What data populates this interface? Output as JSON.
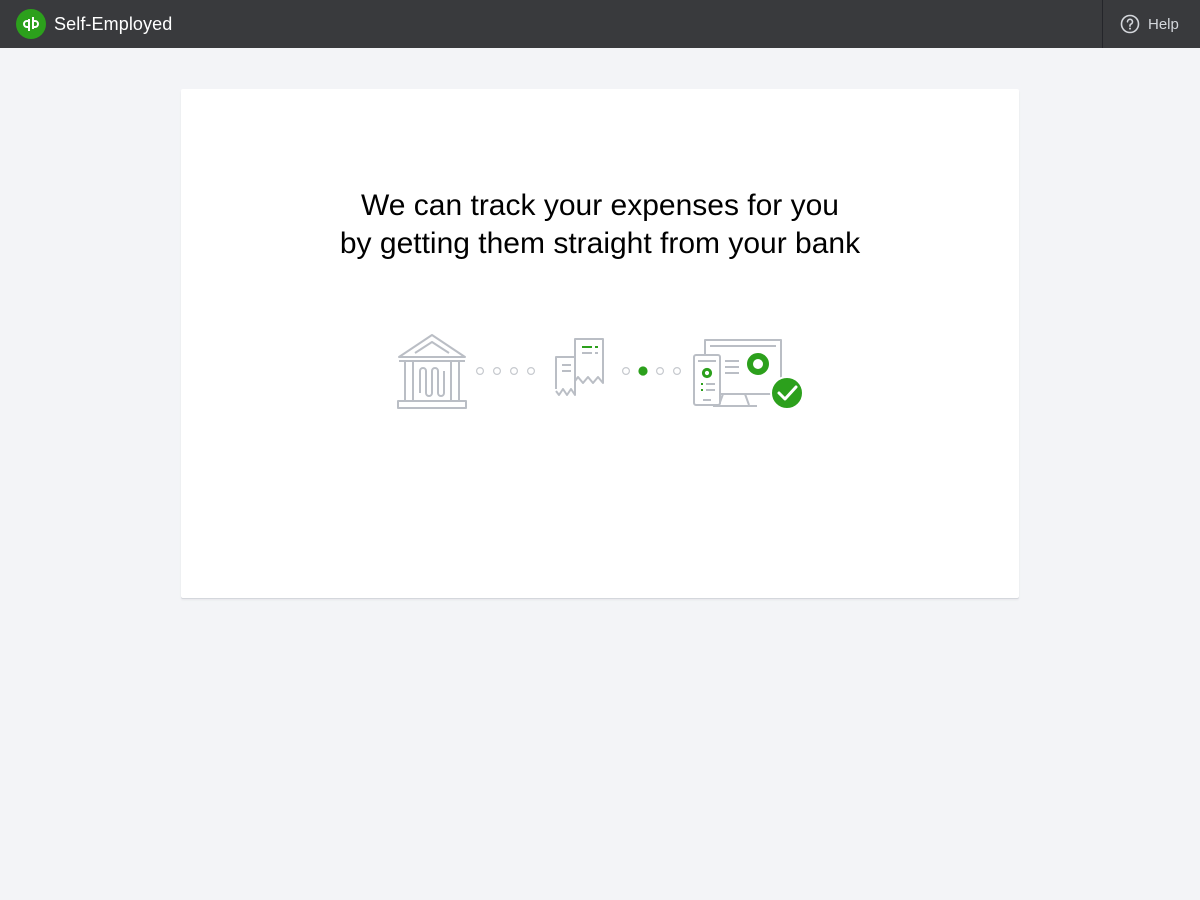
{
  "app": {
    "name": "Self-Employed",
    "logo_text": "qb",
    "brand_color": "#2ca01c"
  },
  "header": {
    "help_label": "Help",
    "help_icon": "question-circle-icon"
  },
  "main": {
    "headline_line1": "We can track your expenses for you",
    "headline_line2": "by getting them straight from your bank",
    "illustration": {
      "steps": [
        "bank-icon",
        "receipt-icon",
        "devices-dashboard-icon"
      ],
      "active_dot": "second connector, second dot",
      "check_icon": "checkmark-badge-icon"
    }
  },
  "colors": {
    "topbar": "#393a3d",
    "background": "#f3f4f7",
    "accent_green": "#2ca01c",
    "icon_gray": "#babec5"
  }
}
